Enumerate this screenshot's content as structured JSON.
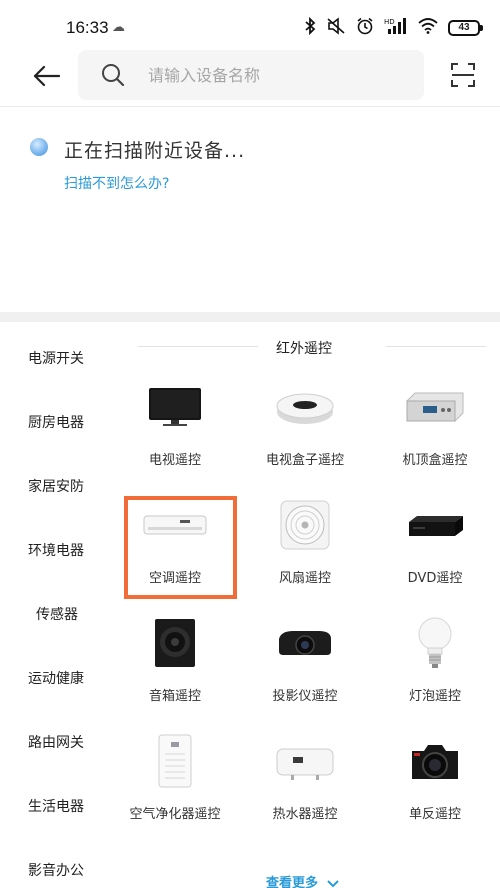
{
  "status_bar": {
    "time": "16:33",
    "battery": "43",
    "icons": [
      "bluetooth-icon",
      "mute-icon",
      "alarm-icon",
      "hd-signal-icon",
      "wifi-icon",
      "battery-icon"
    ]
  },
  "header": {
    "search_placeholder": "请输入设备名称"
  },
  "scan": {
    "status": "正在扫描附近设备...",
    "help_link": "扫描不到怎么办?"
  },
  "sidebar": {
    "items": [
      {
        "label": "电源开关"
      },
      {
        "label": "厨房电器"
      },
      {
        "label": "家居安防"
      },
      {
        "label": "环境电器"
      },
      {
        "label": "传感器"
      },
      {
        "label": "运动健康"
      },
      {
        "label": "路由网关"
      },
      {
        "label": "生活电器"
      },
      {
        "label": "影音办公"
      }
    ]
  },
  "section": {
    "title": "红外遥控",
    "devices": [
      {
        "label": "电视遥控",
        "icon": "tv-icon"
      },
      {
        "label": "电视盒子遥控",
        "icon": "tv-box-icon"
      },
      {
        "label": "机顶盒遥控",
        "icon": "set-top-box-icon"
      },
      {
        "label": "空调遥控",
        "icon": "air-conditioner-icon"
      },
      {
        "label": "风扇遥控",
        "icon": "fan-icon"
      },
      {
        "label": "DVD遥控",
        "icon": "dvd-player-icon"
      },
      {
        "label": "音箱遥控",
        "icon": "speaker-icon"
      },
      {
        "label": "投影仪遥控",
        "icon": "projector-icon"
      },
      {
        "label": "灯泡遥控",
        "icon": "light-bulb-icon"
      },
      {
        "label": "空气净化器遥控",
        "icon": "air-purifier-icon"
      },
      {
        "label": "热水器遥控",
        "icon": "water-heater-icon"
      },
      {
        "label": "单反遥控",
        "icon": "dslr-camera-icon"
      }
    ],
    "see_more": "查看更多"
  },
  "colors": {
    "accent_link": "#2a9bd8",
    "highlight_border": "#f06d3a",
    "section_gap": "#f0f0f0"
  }
}
